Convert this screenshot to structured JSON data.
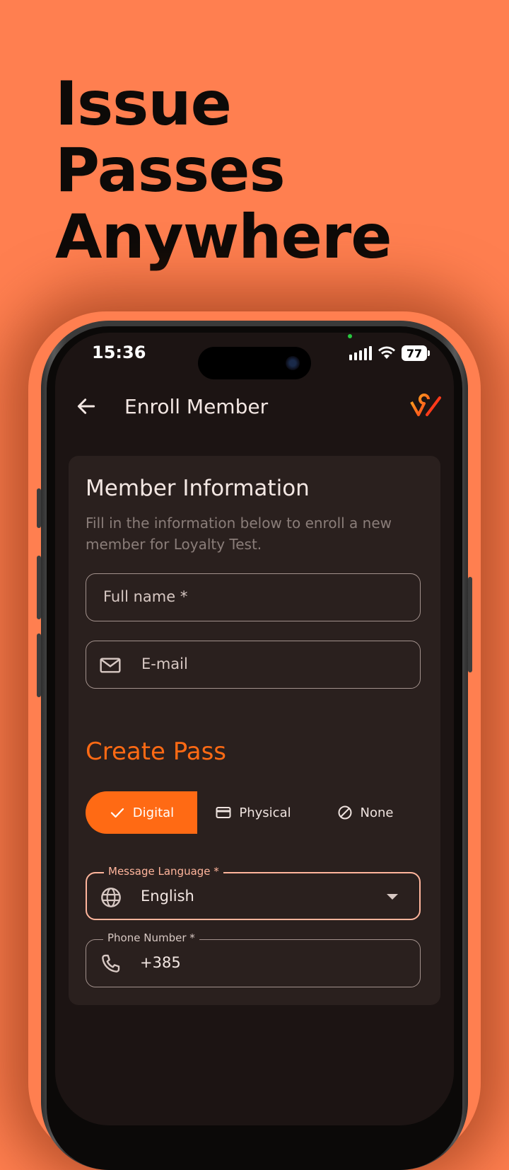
{
  "headline": [
    "Issue",
    "Passes",
    "Anywhere"
  ],
  "status_bar": {
    "time": "15:36",
    "battery": "77"
  },
  "app_bar": {
    "title": "Enroll Member"
  },
  "member_info": {
    "title": "Member Information",
    "description": "Fill in the information below to enroll a new member for Loyalty Test.",
    "full_name_placeholder": "Full name *",
    "email_placeholder": "E-mail"
  },
  "create_pass": {
    "title": "Create Pass",
    "options": [
      {
        "label": "Digital",
        "icon": "check-icon",
        "selected": true
      },
      {
        "label": "Physical",
        "icon": "card-icon",
        "selected": false
      },
      {
        "label": "None",
        "icon": "block-icon",
        "selected": false
      }
    ],
    "language": {
      "label": "Message Language *",
      "value": "English"
    },
    "phone": {
      "label": "Phone Number *",
      "value": "+385"
    }
  },
  "colors": {
    "background": "#FF7F50",
    "accent": "#ff6a14",
    "surface": "#2a201e",
    "focus": "#ffb59c"
  }
}
